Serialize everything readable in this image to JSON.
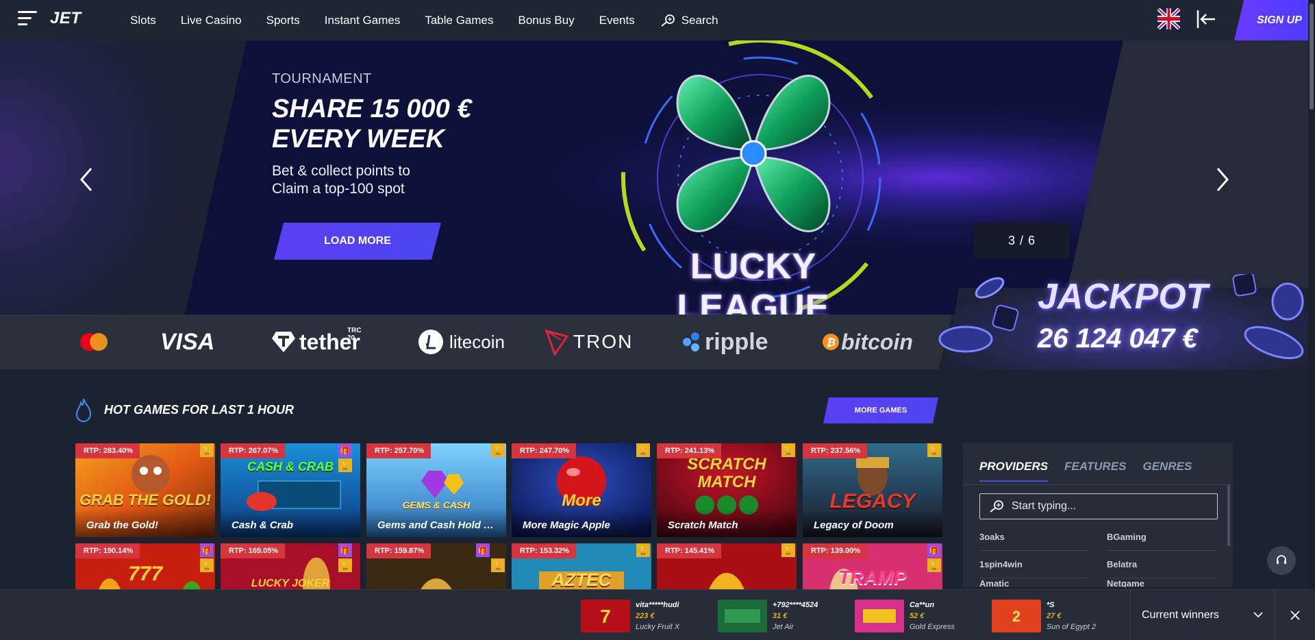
{
  "header": {
    "logo": "JET",
    "nav": [
      "Slots",
      "Live Casino",
      "Sports",
      "Instant Games",
      "Table Games",
      "Bonus Buy",
      "Events"
    ],
    "search_label": "Search",
    "signup_label": "SIGN UP"
  },
  "hero": {
    "eyebrow": "TOURNAMENT",
    "headline_1": "SHARE 15 000 €",
    "headline_2": "EVERY WEEK",
    "sub_1": "Bet & collect points to",
    "sub_2": "Claim a top-100 spot",
    "button": "LOAD MORE",
    "counter": "3 / 6",
    "art_text": "LUCKY LEAGUE"
  },
  "payments": {
    "visa": "VISA",
    "tether": "tether",
    "tether_tag": "TRC 20",
    "litecoin": "litecoin",
    "tron": "TRON",
    "ripple": "ripple",
    "bitcoin": "bitcoin"
  },
  "jackpot": {
    "title": "JACKPOT",
    "value": "26 124 047 €"
  },
  "hot_games": {
    "title": "HOT GAMES FOR LAST 1 HOUR",
    "more_button": "MORE GAMES",
    "row1": [
      {
        "rtp": "RTP: 283.40%",
        "name": "Grab the Gold!",
        "art": "GRAB THE GOLD!"
      },
      {
        "rtp": "RTP: 267.07%",
        "name": "Cash & Crab",
        "art": "CASH & CRAB"
      },
      {
        "rtp": "RTP: 257.70%",
        "name": "Gems and Cash Hold …",
        "art": "GEMS & CASH"
      },
      {
        "rtp": "RTP: 247.70%",
        "name": "More Magic Apple",
        "art": "More"
      },
      {
        "rtp": "RTP: 241.13%",
        "name": "Scratch Match",
        "art": "SCRATCH MATCH"
      },
      {
        "rtp": "RTP: 237.56%",
        "name": "Legacy of Doom",
        "art": "LEGACY"
      }
    ],
    "row2": [
      {
        "rtp": "RTP: 190.14%",
        "art": "777"
      },
      {
        "rtp": "RTP: 169.05%",
        "art": "LUCKY JOKER"
      },
      {
        "rtp": "RTP: 159.87%",
        "art": ""
      },
      {
        "rtp": "RTP: 153.32%",
        "art": "AZTEC"
      },
      {
        "rtp": "RTP: 145.41%",
        "art": ""
      },
      {
        "rtp": "RTP: 139.00%",
        "art": "TRAMP"
      }
    ]
  },
  "providers_panel": {
    "tabs": [
      "PROVIDERS",
      "FEATURES",
      "GENRES"
    ],
    "search_placeholder": "Start typing...",
    "left": [
      "3oaks",
      "1spin4win",
      "Amatic"
    ],
    "right": [
      "BGaming",
      "Belatra",
      "Netgame"
    ]
  },
  "winners": {
    "items": [
      {
        "user": "vita*****hudi",
        "amount": "223 €",
        "game": "Lucky Fruit X"
      },
      {
        "user": "+792****4524",
        "amount": "31 €",
        "game": "Jet Air"
      },
      {
        "user": "Ca**un",
        "amount": "52 €",
        "game": "Gold Express"
      },
      {
        "user": "*S",
        "amount": "27 €",
        "game": "Sun of Egypt 2"
      }
    ],
    "label": "Current winners"
  },
  "colors": {
    "accent": "#5a3ff5",
    "rtp_badge": "#d7353d",
    "gold_badge": "#e8b21e",
    "purple_badge": "#9b4ef0",
    "background": "#1c2330"
  },
  "icons": [
    "menu-icon",
    "search-icon",
    "uk-flag-icon",
    "login-icon",
    "chevron-left-icon",
    "chevron-right-icon",
    "fire-icon",
    "trophy-icon",
    "gift-icon",
    "support-icon",
    "chevron-down-icon",
    "close-icon"
  ]
}
